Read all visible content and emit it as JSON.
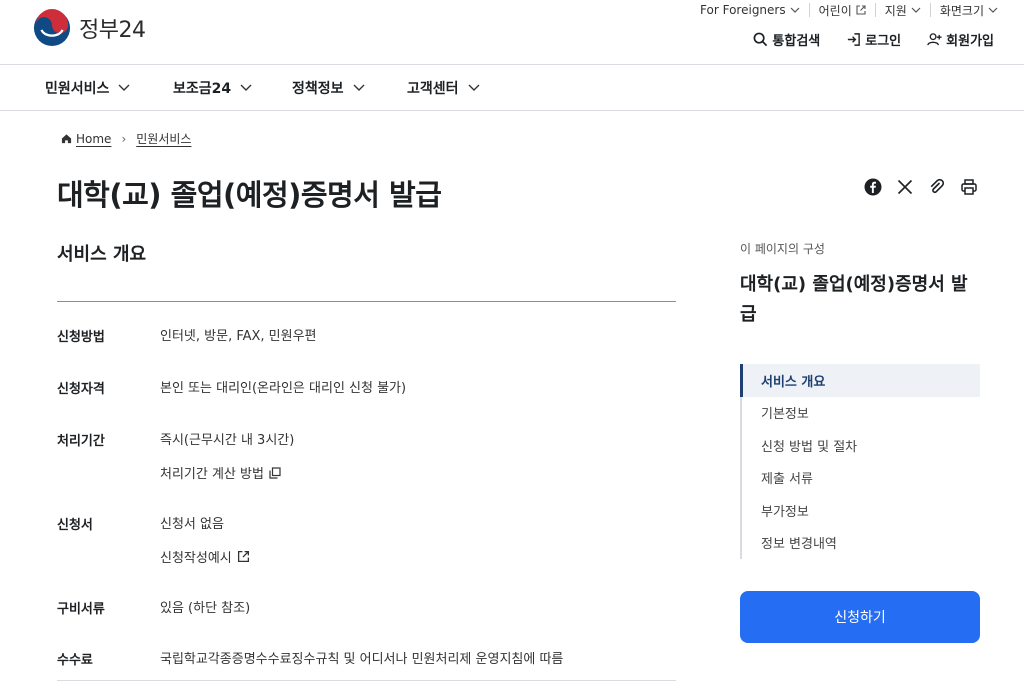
{
  "header": {
    "logo_text": "정부24",
    "util": {
      "foreigners": "For Foreigners",
      "kids": "어린이",
      "support": "지원",
      "screen_size": "화면크기"
    },
    "member": {
      "search": "통합검색",
      "login": "로그인",
      "signup": "회원가입"
    }
  },
  "gnb": {
    "items": [
      "민원서비스",
      "보조금24",
      "정책정보",
      "고객센터"
    ]
  },
  "breadcrumb": {
    "home": "Home",
    "current": "민원서비스"
  },
  "page": {
    "title": "대학(교) 졸업(예정)증명서 발급"
  },
  "overview": {
    "section_title": "서비스 개요",
    "rows": [
      {
        "label": "신청방법",
        "values": [
          "인터넷, 방문, FAX, 민원우편"
        ]
      },
      {
        "label": "신청자격",
        "values": [
          "본인 또는 대리인(온라인은 대리인 신청 불가)"
        ]
      },
      {
        "label": "처리기간",
        "values": [
          "즉시(근무시간 내 3시간)",
          "처리기간 계산 방법"
        ]
      },
      {
        "label": "신청서",
        "values": [
          "신청서 없음",
          "신청작성예시"
        ]
      },
      {
        "label": "구비서류",
        "values": [
          "있음 (하단 참조)"
        ]
      },
      {
        "label": "수수료",
        "values": [
          "국립학교각종증명수수료징수규칙 및 어디서나 민원처리제 운영지침에 따름"
        ]
      }
    ]
  },
  "toc": {
    "caption": "이 페이지의 구성",
    "title": "대학(교) 졸업(예정)증명서 발급",
    "items": [
      "서비스 개요",
      "기본정보",
      "신청 방법 및 절차",
      "제출 서류",
      "부가정보",
      "정보 변경내역"
    ],
    "active_index": 0
  },
  "apply_button": "신청하기",
  "colors": {
    "primary": "#256ef4",
    "navy": "#1d3f73",
    "logo_red": "#cd2e3a",
    "logo_blue": "#0f4a85"
  },
  "icons": {
    "share": [
      "facebook-icon",
      "x-icon",
      "link-icon",
      "print-icon"
    ]
  }
}
